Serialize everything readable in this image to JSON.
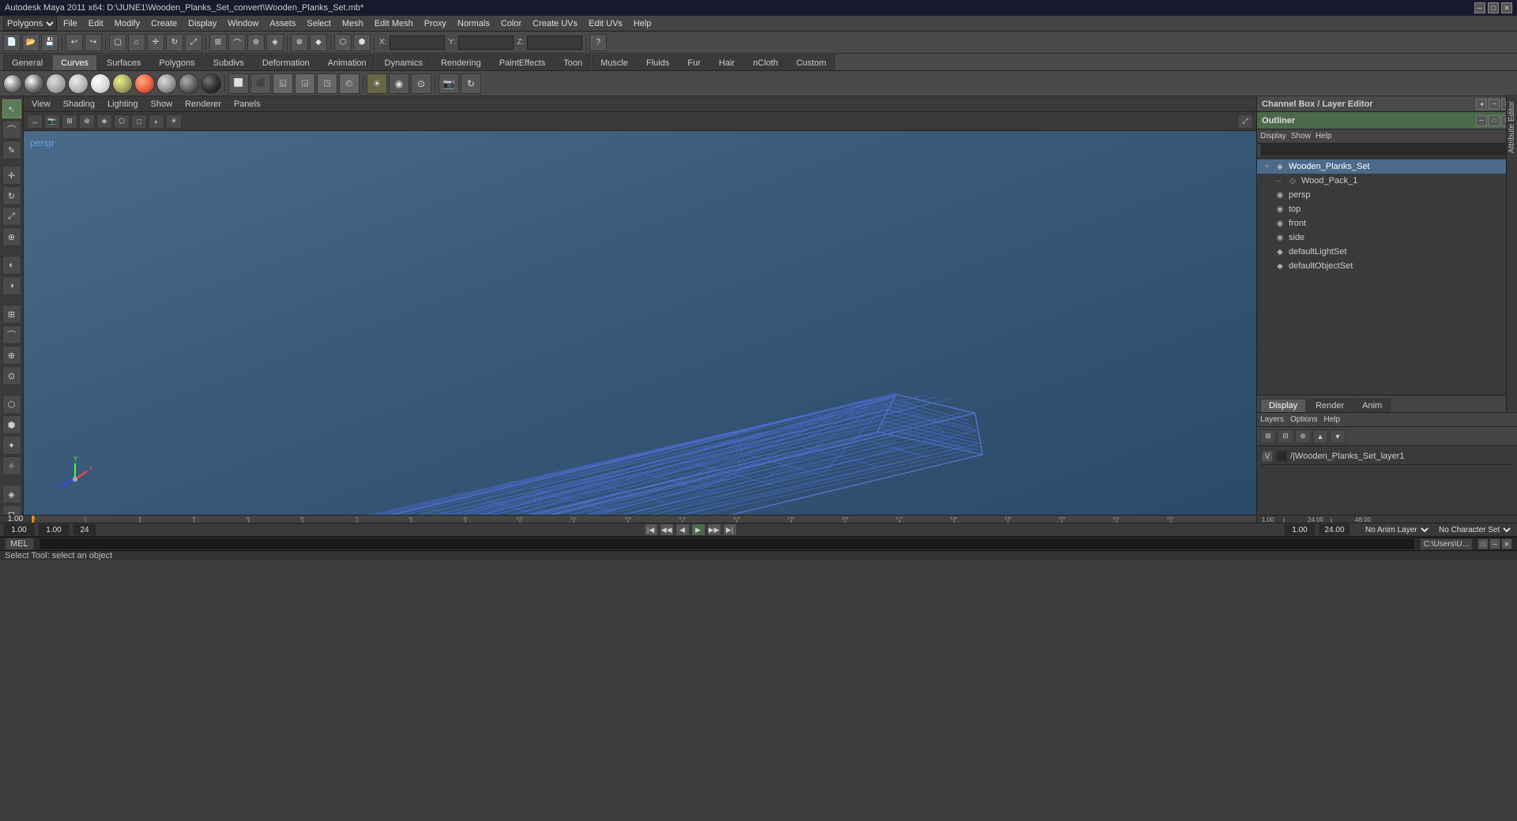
{
  "titlebar": {
    "title": "Autodesk Maya 2011 x64: D:\\JUNE1\\Wooden_Planks_Set_convert\\Wooden_Planks_Set.mb*",
    "minimize": "─",
    "maximize": "□",
    "close": "✕"
  },
  "menubar": {
    "items": [
      "File",
      "Edit",
      "Modify",
      "Create",
      "Display",
      "Window",
      "Assets",
      "Select",
      "Mesh",
      "Edit Mesh",
      "Proxy",
      "Normals",
      "Color",
      "Create UVs",
      "Edit UVs",
      "Help"
    ]
  },
  "modeSelector": "Polygons",
  "tabs": {
    "items": [
      "General",
      "Curves",
      "Surfaces",
      "Polygons",
      "Subdivs",
      "Deformation",
      "Animation",
      "Dynamics",
      "Rendering",
      "PaintEffects",
      "Toon",
      "Muscle",
      "Fluids",
      "Fur",
      "Hair",
      "nCloth",
      "Custom"
    ]
  },
  "viewport": {
    "menus": [
      "View",
      "Shading",
      "Lighting",
      "Show",
      "Renderer",
      "Panels"
    ],
    "perspLabel": "persp",
    "statusLine": "Select Tool: select an object"
  },
  "outliner": {
    "title": "Outliner",
    "menus": [
      "Display",
      "Show",
      "Help"
    ],
    "items": [
      {
        "name": "Wooden_Planks_Set",
        "indent": 0,
        "icon": "◆",
        "expand": "▼",
        "selected": true
      },
      {
        "name": "Wood_Pack_1",
        "indent": 1,
        "icon": "◇",
        "expand": "─",
        "selected": false
      },
      {
        "name": "persp",
        "indent": 0,
        "icon": "◉",
        "expand": "",
        "selected": false
      },
      {
        "name": "top",
        "indent": 0,
        "icon": "◉",
        "expand": "",
        "selected": false
      },
      {
        "name": "front",
        "indent": 0,
        "icon": "◉",
        "expand": "",
        "selected": false
      },
      {
        "name": "side",
        "indent": 0,
        "icon": "◉",
        "expand": "",
        "selected": false
      },
      {
        "name": "defaultLightSet",
        "indent": 0,
        "icon": "◆",
        "expand": "",
        "selected": false
      },
      {
        "name": "defaultObjectSet",
        "indent": 0,
        "icon": "◆",
        "expand": "",
        "selected": false
      }
    ]
  },
  "channelBox": {
    "title": "Channel Box / Layer Editor"
  },
  "bottomTabs": [
    "Display",
    "Render",
    "Anim"
  ],
  "bottomMenus": [
    "Layers",
    "Options",
    "Help"
  ],
  "layers": [
    {
      "vis": "V",
      "name": "/|Wooden_Planks_Set_layer1"
    }
  ],
  "transport": {
    "currentFrame": "1.00",
    "startFrame": "1.00",
    "endFrame": "24",
    "rangeStart": "1.00",
    "rangeEnd": "24.00",
    "nextKey": "48.00",
    "animLayer": "No Anim Layer",
    "charSet": "No Character Set"
  },
  "timeline": {
    "marks": [
      "1",
      "2",
      "3",
      "4",
      "5",
      "6",
      "7",
      "8",
      "9",
      "10",
      "11",
      "12",
      "13",
      "14",
      "15",
      "16",
      "17",
      "18",
      "19",
      "20",
      "21",
      "22"
    ],
    "rightMarks": [
      "1.00",
      "24.00",
      "48.00"
    ]
  },
  "status": {
    "mel": "MEL",
    "helpText": "Select Tool: select an object"
  },
  "commandInput": {
    "value": "",
    "placeholder": ""
  },
  "scriptEditor": {
    "label": "C:\\Users\\U..."
  },
  "icons": {
    "shelves": [
      "●",
      "○",
      "◐",
      "◑",
      "◒",
      "◓",
      "⬤",
      "◎",
      "✦",
      "★",
      "✧",
      "⬡",
      "⬢",
      "◈",
      "⊕"
    ],
    "leftTools": [
      "↖",
      "↔",
      "↕",
      "⟲",
      "✚",
      "⊕",
      "⊗",
      "☉",
      "▣",
      "⊞",
      "⊟",
      "⊠",
      "⊡",
      "⌗",
      "⊕",
      "⊖",
      "⊗"
    ]
  }
}
